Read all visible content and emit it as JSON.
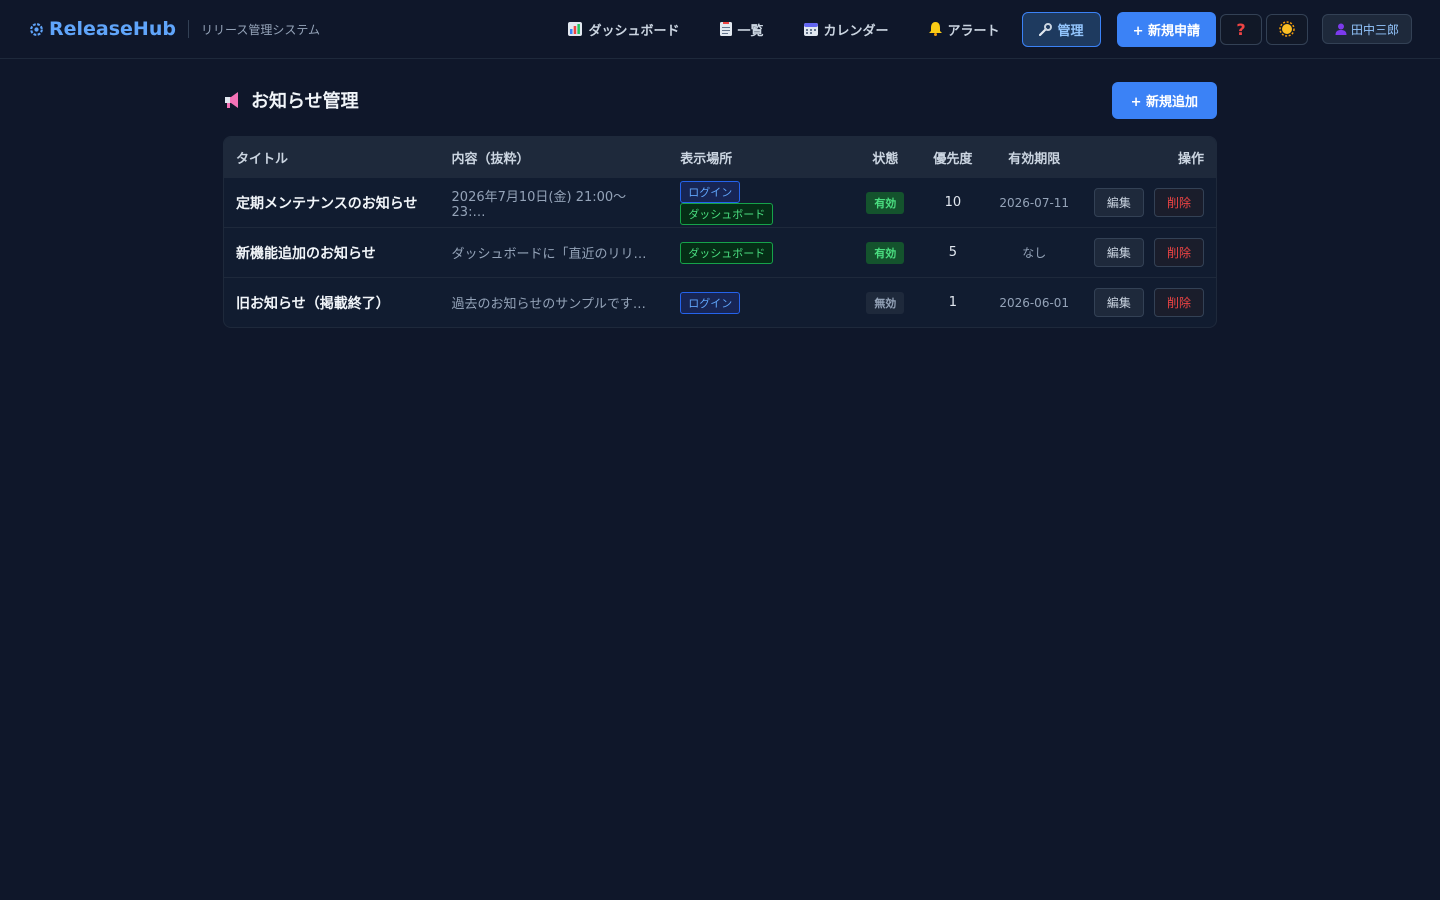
{
  "app": {
    "name": "ReleaseHub",
    "subtitle": "リリース管理システム"
  },
  "nav": {
    "items": [
      {
        "label": "ダッシュボード",
        "icon": "chart-icon"
      },
      {
        "label": "一覧",
        "icon": "list-icon"
      },
      {
        "label": "カレンダー",
        "icon": "calendar-icon"
      },
      {
        "label": "アラート",
        "icon": "bell-icon"
      },
      {
        "label": "管理",
        "icon": "wrench-icon",
        "active": true
      }
    ],
    "new_request_label": "+ 新規申請",
    "help_icon": "question-icon",
    "theme_icon": "sun-icon",
    "user_name": "田中三郎"
  },
  "page": {
    "title": "お知らせ管理",
    "add_label": "+ 新規追加"
  },
  "table": {
    "headers": [
      "タイトル",
      "内容（抜粋）",
      "表示場所",
      "状態",
      "優先度",
      "有効期限",
      "操作"
    ],
    "rows": [
      {
        "title": "定期メンテナンスのお知らせ",
        "excerpt": "2026年7月10日(金) 21:00〜23:…",
        "places": [
          "ログイン",
          "ダッシュボード"
        ],
        "status": "有効",
        "priority": "10",
        "expiry": "2026-07-11",
        "edit": "編集",
        "delete": "削除"
      },
      {
        "title": "新機能追加のお知らせ",
        "excerpt": "ダッシュボードに「直近のリリ…",
        "places": [
          "ダッシュボード"
        ],
        "status": "有効",
        "priority": "5",
        "expiry": "なし",
        "edit": "編集",
        "delete": "削除"
      },
      {
        "title": "旧お知らせ（掲載終了）",
        "excerpt": "過去のお知らせのサンプルです…",
        "places": [
          "ログイン"
        ],
        "status": "無効",
        "priority": "1",
        "expiry": "2026-06-01",
        "edit": "編集",
        "delete": "削除"
      }
    ]
  },
  "colors": {
    "accent": "#3b82f6",
    "background": "#0f172a",
    "active": "#4ade80",
    "danger": "#ef4444"
  }
}
